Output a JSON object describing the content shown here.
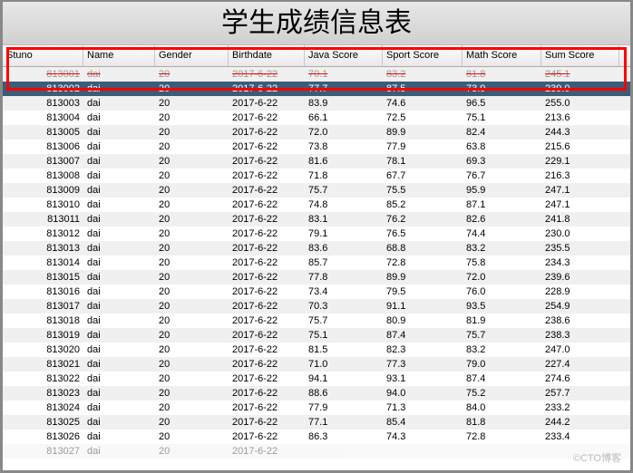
{
  "title": "学生成绩信息表",
  "watermark": "©CTO博客",
  "columns": [
    {
      "key": "stuno",
      "label": "Stuno",
      "class": "col-stuno"
    },
    {
      "key": "name",
      "label": "Name",
      "class": "col-name"
    },
    {
      "key": "gender",
      "label": "Gender",
      "class": "col-gender"
    },
    {
      "key": "birthdate",
      "label": "Birthdate",
      "class": "col-birth"
    },
    {
      "key": "java",
      "label": "Java Score",
      "class": "col-java"
    },
    {
      "key": "sport",
      "label": "Sport Score",
      "class": "col-sport"
    },
    {
      "key": "math",
      "label": "Math Score",
      "class": "col-math"
    },
    {
      "key": "sum",
      "label": "Sum Score",
      "class": "col-sum"
    }
  ],
  "rows": [
    {
      "stuno": "813001",
      "name": "dai",
      "gender": "20",
      "birthdate": "2017-6-22",
      "java": "70.1",
      "sport": "83.2",
      "math": "81.8",
      "sum": "245.1",
      "struck": true
    },
    {
      "stuno": "813002",
      "name": "dai",
      "gender": "20",
      "birthdate": "2017-6-22",
      "java": "77.7",
      "sport": "87.5",
      "math": "73.9",
      "sum": "239.0",
      "selected": true
    },
    {
      "stuno": "813003",
      "name": "dai",
      "gender": "20",
      "birthdate": "2017-6-22",
      "java": "83.9",
      "sport": "74.6",
      "math": "96.5",
      "sum": "255.0"
    },
    {
      "stuno": "813004",
      "name": "dai",
      "gender": "20",
      "birthdate": "2017-6-22",
      "java": "66.1",
      "sport": "72.5",
      "math": "75.1",
      "sum": "213.6"
    },
    {
      "stuno": "813005",
      "name": "dai",
      "gender": "20",
      "birthdate": "2017-6-22",
      "java": "72.0",
      "sport": "89.9",
      "math": "82.4",
      "sum": "244.3"
    },
    {
      "stuno": "813006",
      "name": "dai",
      "gender": "20",
      "birthdate": "2017-6-22",
      "java": "73.8",
      "sport": "77.9",
      "math": "63.8",
      "sum": "215.6"
    },
    {
      "stuno": "813007",
      "name": "dai",
      "gender": "20",
      "birthdate": "2017-6-22",
      "java": "81.6",
      "sport": "78.1",
      "math": "69.3",
      "sum": "229.1"
    },
    {
      "stuno": "813008",
      "name": "dai",
      "gender": "20",
      "birthdate": "2017-6-22",
      "java": "71.8",
      "sport": "67.7",
      "math": "76.7",
      "sum": "216.3"
    },
    {
      "stuno": "813009",
      "name": "dai",
      "gender": "20",
      "birthdate": "2017-6-22",
      "java": "75.7",
      "sport": "75.5",
      "math": "95.9",
      "sum": "247.1"
    },
    {
      "stuno": "813010",
      "name": "dai",
      "gender": "20",
      "birthdate": "2017-6-22",
      "java": "74.8",
      "sport": "85.2",
      "math": "87.1",
      "sum": "247.1"
    },
    {
      "stuno": "813011",
      "name": "dai",
      "gender": "20",
      "birthdate": "2017-6-22",
      "java": "83.1",
      "sport": "76.2",
      "math": "82.6",
      "sum": "241.8"
    },
    {
      "stuno": "813012",
      "name": "dai",
      "gender": "20",
      "birthdate": "2017-6-22",
      "java": "79.1",
      "sport": "76.5",
      "math": "74.4",
      "sum": "230.0"
    },
    {
      "stuno": "813013",
      "name": "dai",
      "gender": "20",
      "birthdate": "2017-6-22",
      "java": "83.6",
      "sport": "68.8",
      "math": "83.2",
      "sum": "235.5"
    },
    {
      "stuno": "813014",
      "name": "dai",
      "gender": "20",
      "birthdate": "2017-6-22",
      "java": "85.7",
      "sport": "72.8",
      "math": "75.8",
      "sum": "234.3"
    },
    {
      "stuno": "813015",
      "name": "dai",
      "gender": "20",
      "birthdate": "2017-6-22",
      "java": "77.8",
      "sport": "89.9",
      "math": "72.0",
      "sum": "239.6"
    },
    {
      "stuno": "813016",
      "name": "dai",
      "gender": "20",
      "birthdate": "2017-6-22",
      "java": "73.4",
      "sport": "79.5",
      "math": "76.0",
      "sum": "228.9"
    },
    {
      "stuno": "813017",
      "name": "dai",
      "gender": "20",
      "birthdate": "2017-6-22",
      "java": "70.3",
      "sport": "91.1",
      "math": "93.5",
      "sum": "254.9"
    },
    {
      "stuno": "813018",
      "name": "dai",
      "gender": "20",
      "birthdate": "2017-6-22",
      "java": "75.7",
      "sport": "80.9",
      "math": "81.9",
      "sum": "238.6"
    },
    {
      "stuno": "813019",
      "name": "dai",
      "gender": "20",
      "birthdate": "2017-6-22",
      "java": "75.1",
      "sport": "87.4",
      "math": "75.7",
      "sum": "238.3"
    },
    {
      "stuno": "813020",
      "name": "dai",
      "gender": "20",
      "birthdate": "2017-6-22",
      "java": "81.5",
      "sport": "82.3",
      "math": "83.2",
      "sum": "247.0"
    },
    {
      "stuno": "813021",
      "name": "dai",
      "gender": "20",
      "birthdate": "2017-6-22",
      "java": "71.0",
      "sport": "77.3",
      "math": "79.0",
      "sum": "227.4"
    },
    {
      "stuno": "813022",
      "name": "dai",
      "gender": "20",
      "birthdate": "2017-6-22",
      "java": "94.1",
      "sport": "93.1",
      "math": "87.4",
      "sum": "274.6"
    },
    {
      "stuno": "813023",
      "name": "dai",
      "gender": "20",
      "birthdate": "2017-6-22",
      "java": "88.6",
      "sport": "94.0",
      "math": "75.2",
      "sum": "257.7"
    },
    {
      "stuno": "813024",
      "name": "dai",
      "gender": "20",
      "birthdate": "2017-6-22",
      "java": "77.9",
      "sport": "71.3",
      "math": "84.0",
      "sum": "233.2"
    },
    {
      "stuno": "813025",
      "name": "dai",
      "gender": "20",
      "birthdate": "2017-6-22",
      "java": "77.1",
      "sport": "85.4",
      "math": "81.8",
      "sum": "244.2"
    },
    {
      "stuno": "813026",
      "name": "dai",
      "gender": "20",
      "birthdate": "2017-6-22",
      "java": "86.3",
      "sport": "74.3",
      "math": "72.8",
      "sum": "233.4"
    },
    {
      "stuno": "813027",
      "name": "dai",
      "gender": "20",
      "birthdate": "2017-6-22",
      "java": "",
      "sport": "",
      "math": "",
      "sum": "",
      "faded": true
    }
  ]
}
